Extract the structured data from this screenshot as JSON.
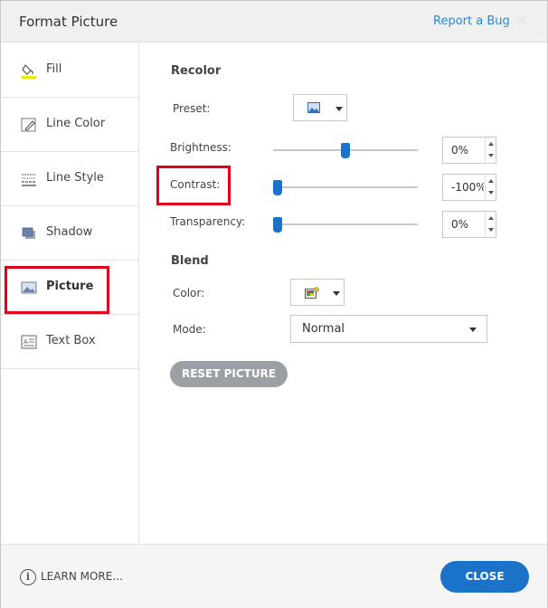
{
  "header": {
    "title": "Format Picture",
    "report_bug": "Report a Bug",
    "close_glyph": "×"
  },
  "sidebar": {
    "items": [
      {
        "label": "Fill",
        "icon": "paint-bucket-icon"
      },
      {
        "label": "Line Color",
        "icon": "pencil-icon"
      },
      {
        "label": "Line Style",
        "icon": "line-style-icon"
      },
      {
        "label": "Shadow",
        "icon": "shadow-icon"
      },
      {
        "label": "Picture",
        "icon": "picture-icon"
      },
      {
        "label": "Text Box",
        "icon": "text-box-icon"
      }
    ],
    "active": "Picture"
  },
  "recolor": {
    "heading": "Recolor",
    "preset_label": "Preset:",
    "brightness_label": "Brightness:",
    "brightness_value": "0%",
    "brightness_level": 0.5,
    "contrast_label": "Contrast:",
    "contrast_value": "-100%",
    "contrast_level": 0.0,
    "transparency_label": "Transparency:",
    "transparency_value": "0%",
    "transparency_level": 0.0
  },
  "blend": {
    "heading": "Blend",
    "color_label": "Color:",
    "mode_label": "Mode:",
    "mode_value": "Normal"
  },
  "reset_label": "RESET PICTURE",
  "footer": {
    "learn_more": "LEARN MORE...",
    "info_glyph": "i",
    "close_label": "CLOSE"
  },
  "colors": {
    "accent": "#1a73c8",
    "highlight": "#e0001b",
    "link": "#2b88d8"
  }
}
